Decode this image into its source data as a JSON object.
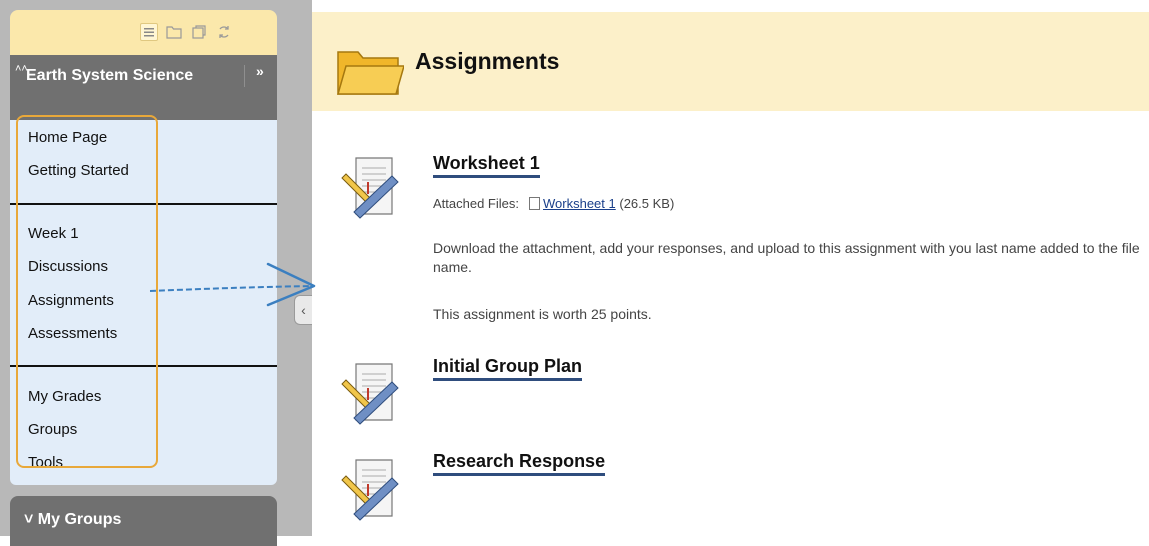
{
  "sidebar": {
    "course_title": "Earth System Science",
    "menu": {
      "group1": [
        "Home Page",
        "Getting Started"
      ],
      "group2": [
        "Week 1",
        "Discussions",
        "Assignments",
        "Assessments"
      ],
      "group3": [
        "My Grades",
        "Groups",
        "Tools"
      ]
    },
    "my_groups_label": "My Groups",
    "toolbar_icons": [
      "list-view-icon",
      "folder-view-icon",
      "window-icon",
      "refresh-icon"
    ],
    "header_icons": [
      "collapse-up-chevrons-icon",
      "expand-double-chevron-icon"
    ]
  },
  "main": {
    "page_title": "Assignments",
    "assignments": [
      {
        "title": "Worksheet 1",
        "attached_label": "Attached Files:",
        "file_name": "Worksheet 1",
        "file_size": "(26.5 KB)",
        "description": "Download the attachment, add your responses, and upload to this assignment with you last name added to the file name.",
        "points": "This assignment is worth 25 points."
      },
      {
        "title": "Initial Group Plan"
      },
      {
        "title": "Research Response"
      }
    ]
  },
  "colors": {
    "menu_bg": "#e2edf9",
    "header_gray": "#707070",
    "toolbar_yellow": "#fbe8ab",
    "title_bar_yellow": "#fcf0c9",
    "highlight_orange": "#e8a83a",
    "annotation_arrow": "#3b7fc0"
  }
}
